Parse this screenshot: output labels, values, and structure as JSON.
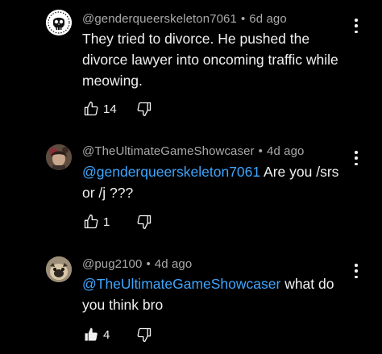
{
  "comments": [
    {
      "author": "@genderqueerskeleton7061",
      "age": "6d ago",
      "separator": "•",
      "text_lines": [
        "They tried to divorce. He pushed the",
        "divorce lawyer into oncoming traffic while",
        "meowing."
      ],
      "likes": "14",
      "liked": false
    },
    {
      "author": "@TheUltimateGameShowcaser",
      "age": "4d ago",
      "separator": "•",
      "mention": "@genderqueerskeleton7061",
      "text_after_mention": " Are you /srs",
      "text_line2": "or /j ???",
      "likes": "1",
      "liked": false
    },
    {
      "author": "@pug2100",
      "age": "4d ago",
      "separator": "•",
      "mention": "@TheUltimateGameShowcaser",
      "text_after_mention": " what do",
      "text_line2": "you think bro",
      "likes": "4",
      "liked": true
    }
  ],
  "icons": {
    "like": "thumbs-up-icon",
    "dislike": "thumbs-down-icon",
    "menu": "more-vert-icon"
  },
  "colors": {
    "background": "#000000",
    "mention": "#3ea6ff",
    "meta": "#aaaaaa",
    "text": "#f1f1f1"
  }
}
